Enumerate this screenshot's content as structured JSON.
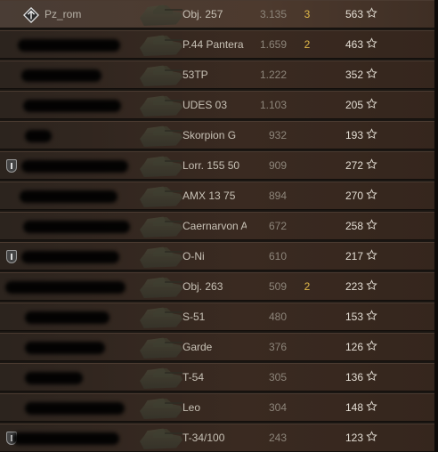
{
  "rows": [
    {
      "player": "Pz_rom",
      "vehicle": "Obj. 257",
      "damage": "3.135",
      "kills": "3",
      "xp": "563",
      "badge": false,
      "blur": []
    },
    {
      "player": "",
      "vehicle": "P.44 Pantera",
      "damage": "1.659",
      "kills": "2",
      "xp": "463",
      "badge": false,
      "blur": [
        [
          20,
          115
        ]
      ]
    },
    {
      "player": "",
      "vehicle": "53TP",
      "damage": "1.222",
      "kills": "",
      "xp": "352",
      "badge": false,
      "blur": [
        [
          24,
          90
        ]
      ]
    },
    {
      "player": "",
      "vehicle": "UDES 03",
      "damage": "1.103",
      "kills": "",
      "xp": "205",
      "badge": false,
      "blur": [
        [
          26,
          110
        ]
      ]
    },
    {
      "player": "",
      "vehicle": "Skorpion G",
      "damage": "932",
      "kills": "",
      "xp": "193",
      "badge": false,
      "blur": [
        [
          28,
          30
        ]
      ]
    },
    {
      "player": "",
      "vehicle": "Lorr. 155 50",
      "damage": "909",
      "kills": "",
      "xp": "272",
      "badge": true,
      "blur": [
        [
          24,
          120
        ]
      ]
    },
    {
      "player": "",
      "vehicle": "AMX 13 75",
      "damage": "894",
      "kills": "",
      "xp": "270",
      "badge": false,
      "blur": [
        [
          22,
          110
        ]
      ]
    },
    {
      "player": "",
      "vehicle": "Caernarvon A",
      "damage": "672",
      "kills": "",
      "xp": "258",
      "badge": false,
      "blur": [
        [
          26,
          120
        ]
      ]
    },
    {
      "player": "",
      "vehicle": "O-Ni",
      "damage": "610",
      "kills": "",
      "xp": "217",
      "badge": true,
      "blur": [
        [
          24,
          110
        ]
      ]
    },
    {
      "player": "",
      "vehicle": "Obj. 263",
      "damage": "509",
      "kills": "2",
      "xp": "223",
      "badge": false,
      "blur": [
        [
          6,
          135
        ]
      ]
    },
    {
      "player": "",
      "vehicle": "S-51",
      "damage": "480",
      "kills": "",
      "xp": "153",
      "badge": false,
      "blur": [
        [
          28,
          95
        ]
      ]
    },
    {
      "player": "",
      "vehicle": "Garde",
      "damage": "376",
      "kills": "",
      "xp": "126",
      "badge": false,
      "blur": [
        [
          28,
          90
        ]
      ]
    },
    {
      "player": "",
      "vehicle": "T-54",
      "damage": "305",
      "kills": "",
      "xp": "136",
      "badge": false,
      "blur": [
        [
          28,
          65
        ]
      ]
    },
    {
      "player": "",
      "vehicle": "Leo",
      "damage": "304",
      "kills": "",
      "xp": "148",
      "badge": false,
      "blur": [
        [
          28,
          112
        ]
      ]
    },
    {
      "player": "",
      "vehicle": "T-34/100",
      "damage": "243",
      "kills": "",
      "xp": "123",
      "badge": true,
      "blur": [
        [
          14,
          120
        ]
      ]
    }
  ],
  "colors": {
    "kills": "#e0b84a",
    "xp": "#e4ded4",
    "damage": "#8d857a"
  },
  "icons": {
    "rank": "rank-icon",
    "star": "star-icon",
    "badge": "clan-badge-icon",
    "tank": "tank-icon"
  }
}
